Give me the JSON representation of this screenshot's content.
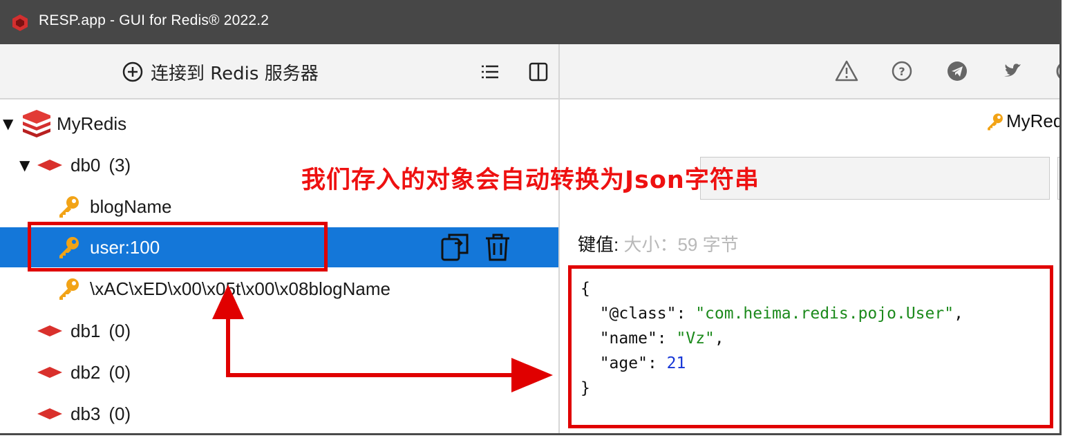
{
  "window": {
    "title": "RESP.app - GUI for Redis® 2022.2"
  },
  "left_toolbar": {
    "connect_label": "连接到 Redis 服务器"
  },
  "tree": {
    "connection": "MyRedis",
    "databases": [
      {
        "name": "db0",
        "count": "(3)"
      },
      {
        "name": "db1",
        "count": "(0)"
      },
      {
        "name": "db2",
        "count": "(0)"
      },
      {
        "name": "db3",
        "count": "(0)"
      }
    ],
    "keys": [
      "blogName",
      "user:100",
      "\\xAC\\xED\\x00\\x05t\\x00\\x08blogName"
    ]
  },
  "right_pane": {
    "key_tab": "MyRed",
    "value_label": "键值:",
    "value_size": "大小：59 字节",
    "json_lines": {
      "open": "{",
      "class_key": "\"@class\"",
      "class_value": "\"com.heima.redis.pojo.User\"",
      "name_key": "\"name\"",
      "name_value": "\"Vz\"",
      "age_key": "\"age\"",
      "age_value": "21",
      "close": "}"
    }
  },
  "annotation": {
    "text_before": "我们存入的对象会自动转换为",
    "text_bold": "Json",
    "text_after": "字符串"
  },
  "colors": {
    "titlebar": "#474747",
    "selection": "#1477d9",
    "annotation_red": "#e00000",
    "key_icon": "#f2a316",
    "db_icon": "#d9302c"
  },
  "icons": {
    "connect": "plus-circle-icon",
    "list": "list-icon",
    "layout": "split-layout-icon",
    "warning": "warning-icon",
    "help": "help-icon",
    "telegram": "telegram-icon",
    "twitter": "twitter-icon",
    "key": "key-icon",
    "db": "database-icon",
    "copy": "copy-icon",
    "delete": "trash-icon"
  }
}
